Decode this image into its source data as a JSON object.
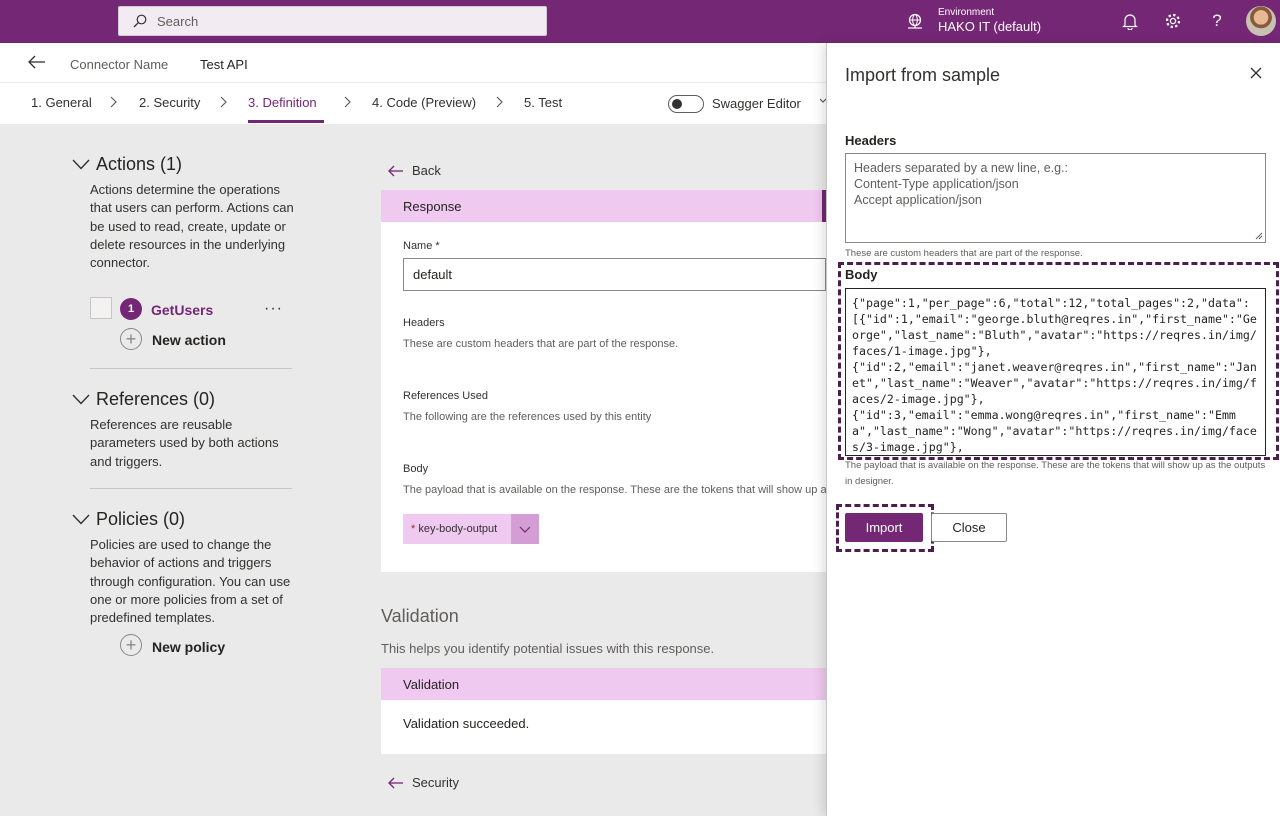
{
  "topbar": {
    "search_placeholder": "Search",
    "environment_label": "Environment",
    "environment_name": "HAKO IT (default)",
    "bar_color": "#742774"
  },
  "header": {
    "connector_label": "Connector Name",
    "connector_name": "Test API"
  },
  "steps": [
    "1. General",
    "2. Security",
    "3. Definition",
    "4. Code (Preview)",
    "5. Test"
  ],
  "active_step": "3. Definition",
  "swagger_label": "Swagger Editor",
  "left": {
    "actions": {
      "title": "Actions (1)",
      "desc": "Actions determine the operations that users can perform. Actions can be used to read, create, update or delete resources in the underlying connector.",
      "item_number": "1",
      "item_name": "GetUsers",
      "more": "···",
      "new_label": "New action"
    },
    "references": {
      "title": "References (0)",
      "desc": "References are reusable parameters used by both actions and triggers."
    },
    "policies": {
      "title": "Policies (0)",
      "desc": "Policies are used to change the behavior of actions and triggers through configuration. You can use one or more policies from a set of predefined templates.",
      "new_label": "New policy"
    }
  },
  "center": {
    "back": "Back",
    "response_title": "Response",
    "name_label": "Name *",
    "name_value": "default",
    "headers_label": "Headers",
    "headers_desc": "These are custom headers that are part of the response.",
    "refs_label": "References Used",
    "refs_desc": "The following are the references used by this entity",
    "body_label": "Body",
    "body_desc": "The payload that is available on the response. These are the tokens that will show up as",
    "token_required": "*",
    "token_label": "key-body-output",
    "validation_title": "Validation",
    "validation_desc": "This helps you identify potential issues with this response.",
    "validation_head": "Validation",
    "validation_msg": "Validation succeeded.",
    "security_link": "Security"
  },
  "panel": {
    "title": "Import from sample",
    "headers_label": "Headers",
    "headers_placeholder": "Headers separated by a new line, e.g.:\nContent-Type application/json\nAccept application/json",
    "headers_hint": "These are custom headers that are part of the response.",
    "body_label": "Body",
    "body_value": "{\"page\":1,\"per_page\":6,\"total\":12,\"total_pages\":2,\"data\":\n[{\"id\":1,\"email\":\"george.bluth@reqres.in\",\"first_name\":\"George\",\"last_name\":\"Bluth\",\"avatar\":\"https://reqres.in/img/faces/1-image.jpg\"},\n{\"id\":2,\"email\":\"janet.weaver@reqres.in\",\"first_name\":\"Janet\",\"last_name\":\"Weaver\",\"avatar\":\"https://reqres.in/img/faces/2-image.jpg\"},\n{\"id\":3,\"email\":\"emma.wong@reqres.in\",\"first_name\":\"Emma\",\"last_name\":\"Wong\",\"avatar\":\"https://reqres.in/img/faces/3-image.jpg\"},",
    "body_hint": "The payload that is available on the response. These are the tokens that will show up as the outputs in designer.",
    "import_label": "Import",
    "close_label": "Close"
  },
  "colors": {
    "accent": "#742774",
    "accent_light": "#efc9ef",
    "highlight_frame": "#4b1f4b"
  }
}
